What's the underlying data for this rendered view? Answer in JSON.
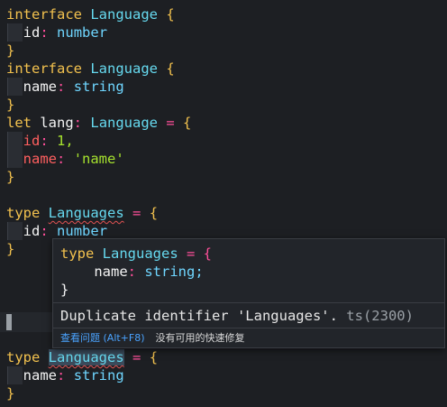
{
  "editor": {
    "keywords": {
      "interface": "interface",
      "let": "let",
      "type": "type"
    },
    "type_name": "Language",
    "type_name_plural": "Languages",
    "open_brace": "{",
    "close_brace": "}",
    "lines": {
      "l1_prop": "id",
      "l1_type": "number",
      "l2_prop": "name",
      "l2_type": "string",
      "let_var": "lang",
      "let_id": "id",
      "let_id_value": "1,",
      "let_name": "name",
      "let_name_value": "'name'",
      "t1_prop": "id",
      "t1_type": "number",
      "t2_prop": "name",
      "t2_type": "string"
    }
  },
  "hover": {
    "preview_line1_kw": "type",
    "preview_line1_name": "Languages",
    "preview_line1_rest": "= {",
    "preview_line2_prop": "name",
    "preview_line2_type": "string;",
    "preview_line3": "}",
    "message": "Duplicate identifier 'Languages'.",
    "code": "ts(2300)",
    "action_view_problem": "查看问题 (Alt+F8)",
    "action_no_fix": "没有可用的快速修复"
  }
}
